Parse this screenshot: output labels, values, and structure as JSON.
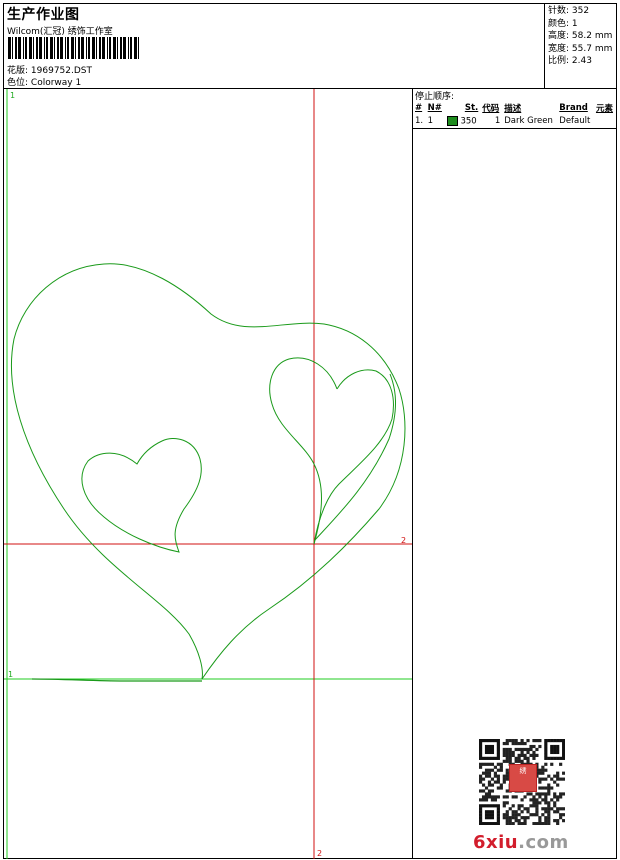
{
  "header": {
    "title": "生产作业图",
    "company": "Wilcom(汇冠) 绣饰工作室",
    "file_label": "花版:",
    "file_value": "1969752.DST",
    "colorway_label": "色位:",
    "colorway_value": "Colorway 1"
  },
  "stats": [
    {
      "label": "针数:",
      "value": "352"
    },
    {
      "label": "颜色:",
      "value": "1"
    },
    {
      "label": "高度:",
      "value": "58.2 mm"
    },
    {
      "label": "宽度:",
      "value": "55.7 mm"
    },
    {
      "label": "比例:",
      "value": "2.43"
    }
  ],
  "design": {
    "markers": {
      "top_left": "1",
      "left_mid": "1",
      "right_h": "2",
      "bottom_v": "2"
    },
    "thread_color": "#1a9a1a",
    "guide_color": "#d01010",
    "frame_color": "#22cc22"
  },
  "stops": {
    "title": "停止顺序:",
    "columns": [
      "#",
      "N#",
      "St.",
      "代码",
      "描述",
      "Brand",
      "元素"
    ],
    "rows": [
      {
        "num": "1.",
        "n": "1",
        "color": "#1e8c1e",
        "stitches": "350",
        "code": "1",
        "description": "Dark Green",
        "brand": "Default",
        "element": ""
      }
    ]
  },
  "watermark": {
    "text": "6xiu",
    "tld": ".com",
    "seal": "绣"
  }
}
